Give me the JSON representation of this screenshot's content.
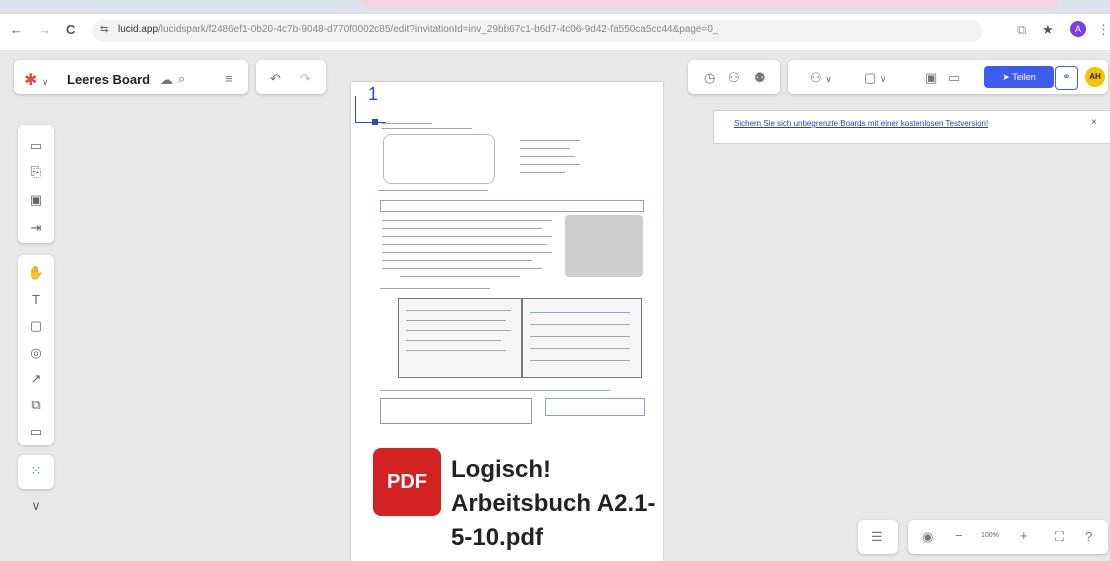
{
  "browser": {
    "url_host": "lucid.app",
    "url_path": "/lucidspark/f2486ef1-0b20-4c7b-9048-d770f0002c85/edit?invitationId=inv_29bb67c1-b6d7-4c06-9d42-fa550ca5cc44&page=0_0#",
    "back": "←",
    "forward": "→",
    "reload": "C",
    "profile": "A"
  },
  "board": {
    "title": "Leeres Board",
    "logo": "✱"
  },
  "document": {
    "page_number": "1",
    "pdf_badge": "PDF",
    "pdf_name": "Logisch! Arbeitsbuch A2.1-5-10.pdf"
  },
  "banner": {
    "text": "Sichern Sie sich unbegrenzte Boards mit einer kostenlosen Testversion!",
    "close": "×"
  },
  "topbar": {
    "share_label": "Teilen",
    "avatar_initials": "AH"
  },
  "zoom": {
    "level": "100%",
    "minus": "−",
    "plus": "+"
  },
  "icons": {
    "cloud": "cloud-icon",
    "search": "search-icon",
    "menu": "menu-icon",
    "undo": "undo-icon",
    "redo": "redo-icon",
    "timer": "timer-icon",
    "collab": "collaborators-icon",
    "people": "people-icon",
    "comments": "comment-icon",
    "present": "present-icon",
    "video": "video-icon",
    "send": "send-icon",
    "link": "link-icon",
    "close": "close-icon",
    "outline": "outline-icon",
    "help": "help-icon",
    "fit": "fit-screen-icon"
  }
}
